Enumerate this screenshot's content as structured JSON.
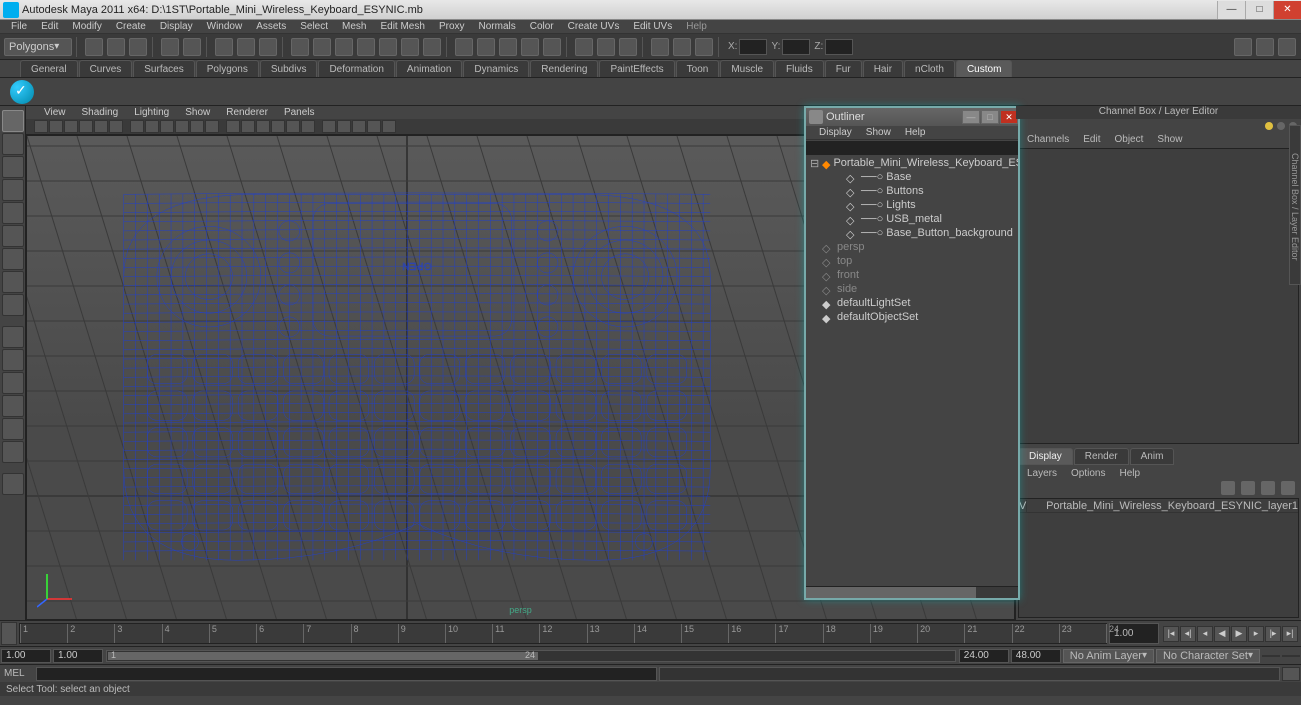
{
  "titlebar": {
    "text": "Autodesk Maya 2011 x64: D:\\1ST\\Portable_Mini_Wireless_Keyboard_ESYNIC.mb"
  },
  "menu": [
    "File",
    "Edit",
    "Modify",
    "Create",
    "Display",
    "Window",
    "Assets",
    "Select",
    "Mesh",
    "Edit Mesh",
    "Proxy",
    "Normals",
    "Color",
    "Create UVs",
    "Edit UVs",
    "Help"
  ],
  "moduleSelector": "Polygons",
  "coordLabels": {
    "x": "X:",
    "y": "Y:",
    "z": "Z:"
  },
  "shelfTabs": [
    "General",
    "Curves",
    "Surfaces",
    "Polygons",
    "Subdivs",
    "Deformation",
    "Animation",
    "Dynamics",
    "Rendering",
    "PaintEffects",
    "Toon",
    "Muscle",
    "Fluids",
    "Fur",
    "Hair",
    "nCloth",
    "Custom"
  ],
  "shelfActive": "Custom",
  "vpMenu": [
    "View",
    "Shading",
    "Lighting",
    "Show",
    "Renderer",
    "Panels"
  ],
  "perspLabel": "persp",
  "outliner": {
    "title": "Outliner",
    "menu": [
      "Display",
      "Show",
      "Help"
    ],
    "items": [
      {
        "label": "Portable_Mini_Wireless_Keyboard_ESYNIC",
        "level": 1,
        "dim": false,
        "exp": "-"
      },
      {
        "label": "Base",
        "level": 2,
        "dim": false,
        "exp": ""
      },
      {
        "label": "Buttons",
        "level": 2,
        "dim": false,
        "exp": ""
      },
      {
        "label": "Lights",
        "level": 2,
        "dim": false,
        "exp": ""
      },
      {
        "label": "USB_metal",
        "level": 2,
        "dim": false,
        "exp": ""
      },
      {
        "label": "Base_Button_background",
        "level": 2,
        "dim": false,
        "exp": ""
      },
      {
        "label": "persp",
        "level": 1,
        "dim": true,
        "exp": ""
      },
      {
        "label": "top",
        "level": 1,
        "dim": true,
        "exp": ""
      },
      {
        "label": "front",
        "level": 1,
        "dim": true,
        "exp": ""
      },
      {
        "label": "side",
        "level": 1,
        "dim": true,
        "exp": ""
      },
      {
        "label": "defaultLightSet",
        "level": 1,
        "dim": false,
        "exp": ""
      },
      {
        "label": "defaultObjectSet",
        "level": 1,
        "dim": false,
        "exp": ""
      }
    ]
  },
  "channelBox": {
    "title": "Channel Box / Layer Editor",
    "menu": [
      "Channels",
      "Edit",
      "Object",
      "Show"
    ],
    "tabs": [
      "Display",
      "Render",
      "Anim"
    ],
    "tabActive": "Display",
    "menu2": [
      "Layers",
      "Options",
      "Help"
    ],
    "layerRow": {
      "v": "V",
      "name": "Portable_Mini_Wireless_Keyboard_ESYNIC_layer1"
    },
    "sideTab": "Channel Box / Layer Editor"
  },
  "timeline": {
    "ticks": [
      "1",
      "2",
      "3",
      "4",
      "5",
      "6",
      "7",
      "8",
      "9",
      "10",
      "11",
      "12",
      "13",
      "14",
      "15",
      "16",
      "17",
      "18",
      "19",
      "20",
      "21",
      "22",
      "23",
      "24"
    ],
    "endField": "1.00"
  },
  "range": {
    "startOuter": "1.00",
    "startInner": "1.00",
    "sliderStart": "1",
    "sliderEnd": "24",
    "endInner": "24.00",
    "endOuter": "48.00",
    "animLayer": "No Anim Layer",
    "charSet": "No Character Set"
  },
  "cmd": {
    "label": "MEL"
  },
  "helpLine": "Select Tool: select an object"
}
